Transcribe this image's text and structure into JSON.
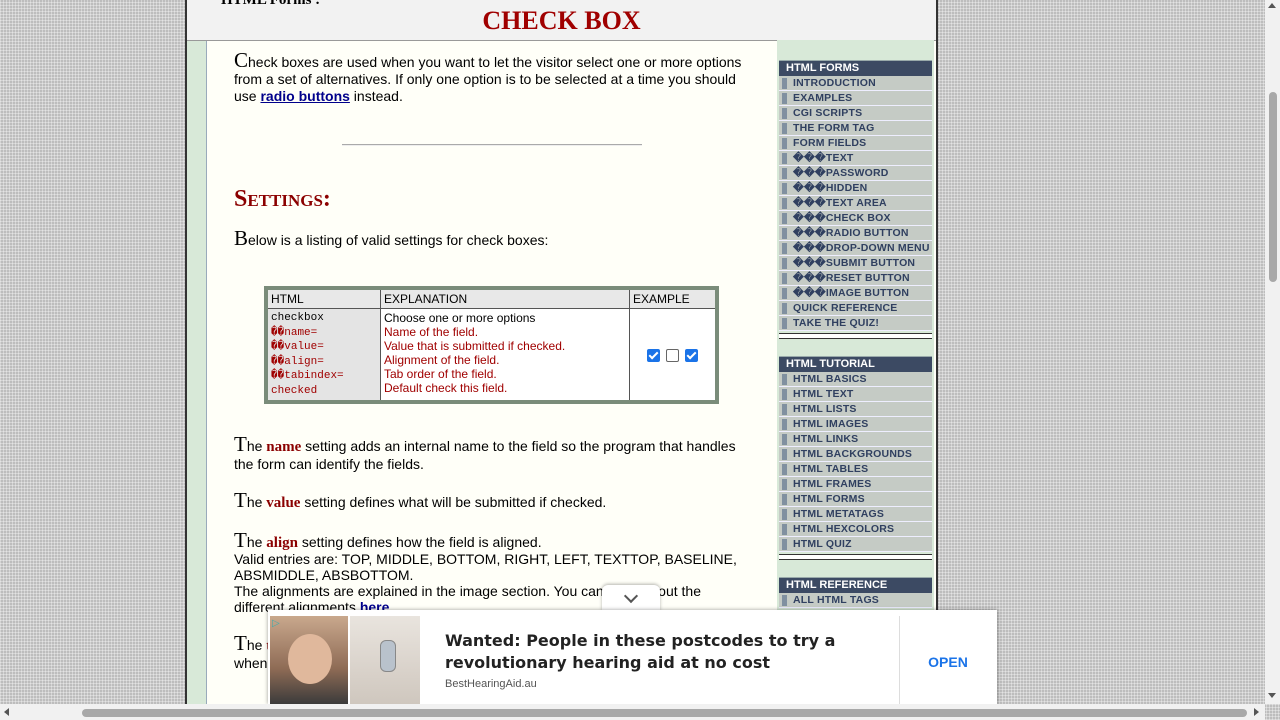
{
  "header": {
    "crumb": "HTML Forms :",
    "title": "CHECK BOX"
  },
  "intro": {
    "first_letter": "C",
    "text_before": "heck boxes are used when you want to let the visitor select one or more options from a set of alternatives. If only one option is to be selected at a time you should use ",
    "link": "radio buttons",
    "text_after": " instead."
  },
  "settings": {
    "heading": "Settings:",
    "first_letter": "B",
    "text": "elow is a listing of valid settings for check boxes:"
  },
  "table": {
    "headers": [
      "HTML",
      "EXPLANATION",
      "EXAMPLE"
    ],
    "code": [
      "checkbox",
      "��name=",
      "��value=",
      "��align=",
      "��tabindex=",
      "checked"
    ],
    "explanations": [
      "Choose one or more options",
      "Name of the field.",
      "Value that is submitted if checked.",
      "Alignment of the field.",
      "Tab order of the field.",
      "Default check this field."
    ],
    "example_states": [
      true,
      false,
      true
    ]
  },
  "p_name": {
    "first_letter": "T",
    "pre": "he ",
    "kw": "name",
    "post": " setting adds an internal name to the field so the program that handles the form can identify the fields."
  },
  "p_value": {
    "first_letter": "T",
    "pre": "he ",
    "kw": "value",
    "post": " setting defines what will be submitted if checked."
  },
  "p_align": {
    "first_letter": "T",
    "pre": "he ",
    "kw": "align",
    "post": " setting defines how the field is aligned.",
    "line2": "Valid entries are: TOP, MIDDLE, BOTTOM, RIGHT, LEFT, TEXTTOP, BASELINE, ABSMIDDLE, ABSBOTTOM.",
    "line3": "The alignments are explained in the image section. You can learn about the different alignments ",
    "link": "here"
  },
  "p_tab": {
    "first_letter": "T",
    "pre": "he ",
    "kw": "t",
    "line2": "when"
  },
  "sidebar": {
    "forms": {
      "heading": "HTML FORMS",
      "items": [
        "INTRODUCTION",
        "EXAMPLES",
        "CGI SCRIPTS",
        "THE FORM TAG",
        "FORM FIELDS",
        "���TEXT",
        "���PASSWORD",
        "���HIDDEN",
        "���TEXT AREA",
        "���CHECK BOX",
        "���RADIO BUTTON",
        "���DROP-DOWN MENU",
        "���SUBMIT BUTTON",
        "���RESET BUTTON",
        "���IMAGE BUTTON",
        "QUICK REFERENCE",
        "TAKE THE QUIZ!"
      ]
    },
    "tutorial": {
      "heading": "HTML TUTORIAL",
      "items": [
        "HTML BASICS",
        "HTML TEXT",
        "HTML LISTS",
        "HTML IMAGES",
        "HTML LINKS",
        "HTML BACKGROUNDS",
        "HTML TABLES",
        "HTML FRAMES",
        "HTML FORMS",
        "HTML METATAGS",
        "HTML HEXCOLORS",
        "HTML QUIZ"
      ]
    },
    "reference": {
      "heading": "HTML REFERENCE",
      "items": [
        "ALL HTML TAGS"
      ]
    }
  },
  "ad": {
    "headline": "Wanted: People in these postcodes to try a revolutionary hearing aid at no cost",
    "source": "BestHearingAid.au",
    "cta": "OPEN",
    "adchoice": "▷"
  }
}
